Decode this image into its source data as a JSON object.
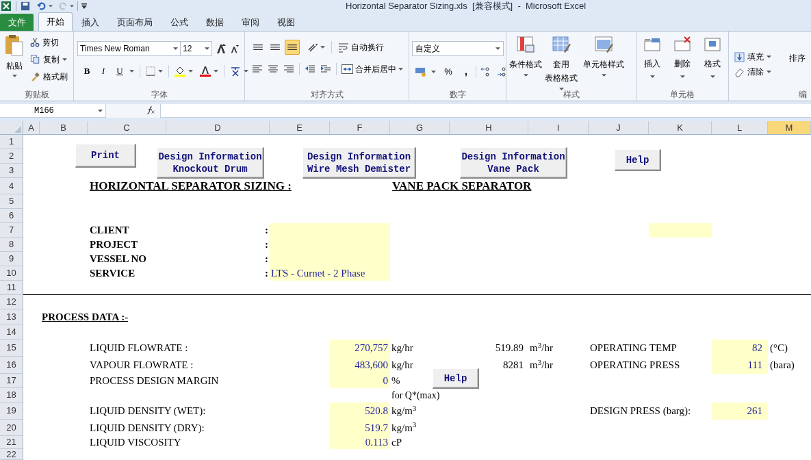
{
  "window": {
    "title": "Horizontal Separator Sizing.xls  [兼容模式]  -  Microsoft Excel"
  },
  "ribbon_tabs": [
    {
      "label": "文件",
      "kind": "file",
      "selected": false
    },
    {
      "label": "开始",
      "kind": "tab",
      "selected": true
    },
    {
      "label": "插入",
      "kind": "tab",
      "selected": false
    },
    {
      "label": "页面布局",
      "kind": "tab",
      "selected": false
    },
    {
      "label": "公式",
      "kind": "tab",
      "selected": false
    },
    {
      "label": "数据",
      "kind": "tab",
      "selected": false
    },
    {
      "label": "审阅",
      "kind": "tab",
      "selected": false
    },
    {
      "label": "视图",
      "kind": "tab",
      "selected": false
    }
  ],
  "ribbon": {
    "clipboard": {
      "paste": "粘贴",
      "cut": "剪切",
      "copy": "复制",
      "format_painter": "格式刷",
      "label": "剪贴板"
    },
    "font": {
      "font_name": "Times New Roman",
      "font_size": "12",
      "styles": [
        "B",
        "I",
        "U"
      ],
      "label": "字体"
    },
    "alignment": {
      "vertical": [
        {
          "selected": false
        },
        {
          "selected": false
        },
        {
          "selected": true
        }
      ],
      "wrap_text": "自动换行",
      "merge_center": "合并后居中",
      "label": "对齐方式"
    },
    "number": {
      "format": "自定义",
      "percent": "%",
      "comma": ",",
      "label": "数字"
    },
    "styles": {
      "buttons": [
        [
          "条件格式"
        ],
        [
          "套用",
          "表格格式"
        ],
        [
          "单元格样式"
        ]
      ],
      "label": "样式"
    },
    "cells": {
      "buttons": [
        "插入",
        "删除",
        "格式"
      ],
      "label": "单元格"
    },
    "editing": {
      "fill": "填充",
      "clear": "清除",
      "sort": "排序",
      "label": "编"
    }
  },
  "formula_bar": {
    "name_box": "M166"
  },
  "columns": [
    {
      "label": "A",
      "selected": false
    },
    {
      "label": "B",
      "selected": false
    },
    {
      "label": "C",
      "selected": false
    },
    {
      "label": "D",
      "selected": false
    },
    {
      "label": "E",
      "selected": false
    },
    {
      "label": "F",
      "selected": false
    },
    {
      "label": "G",
      "selected": false
    },
    {
      "label": "H",
      "selected": false
    },
    {
      "label": "I",
      "selected": false
    },
    {
      "label": "J",
      "selected": false
    },
    {
      "label": "K",
      "selected": false
    },
    {
      "label": "L",
      "selected": false
    },
    {
      "label": "M",
      "selected": true
    }
  ],
  "rows": [
    "1",
    "2",
    "3",
    "4",
    "5",
    "6",
    "7",
    "8",
    "9",
    "10",
    "11",
    "12",
    "13",
    "14",
    "15",
    "16",
    "17",
    "18",
    "19",
    "20",
    "21",
    "22"
  ],
  "sheet": {
    "buttons": [
      "Print",
      "Design Information\nKnockout Drum",
      "Design Information\nWire Mesh Demister",
      "Design Information\nVane Pack",
      "Help",
      "Help"
    ],
    "title_left": "HORIZONTAL SEPARATOR SIZING :",
    "title_right": "VANE PACK SEPARATOR",
    "info": [
      {
        "label": "CLIENT",
        "separator": ":"
      },
      {
        "label": "PROJECT",
        "separator": ":"
      },
      {
        "label": "VESSEL NO",
        "separator": ":"
      },
      {
        "label": "SERVICE",
        "separator": ":",
        "value": "LTS - Curnet - 2 Phase"
      }
    ],
    "process_title": "PROCESS DATA :-",
    "process": [
      {
        "label": "LIQUID FLOWRATE :",
        "value": "270,757",
        "unit": "kg/hr",
        "flow_value": "519.89",
        "flow_unit": "m$^{3}$/hr",
        "right_label": "OPERATING TEMP",
        "right_value": "82",
        "right_unit": "(°C)"
      },
      {
        "label": "VAPOUR FLOWRATE :",
        "value": "483,600",
        "unit": "kg/hr",
        "flow_value": "8281",
        "flow_unit": "m$^{3}$/hr",
        "right_label": "OPERATING PRESS",
        "right_value": "111",
        "right_unit": "(bara)"
      },
      {
        "label": "PROCESS DESIGN MARGIN",
        "value": "0",
        "unit": "%"
      },
      {
        "note": "for Q*(max)"
      },
      {
        "label": "LIQUID DENSITY (WET):",
        "value": "520.8",
        "unit": "kg/m$^{3}$",
        "right_label": "DESIGN PRESS (barg):",
        "right_value": "261"
      },
      {
        "label": "LIQUID DENSITY (DRY):",
        "value": "519.7",
        "unit": "kg/m$^{3}$"
      },
      {
        "label": "LIQUID VISCOSITY",
        "value": "0.113",
        "unit": "cP"
      }
    ]
  }
}
